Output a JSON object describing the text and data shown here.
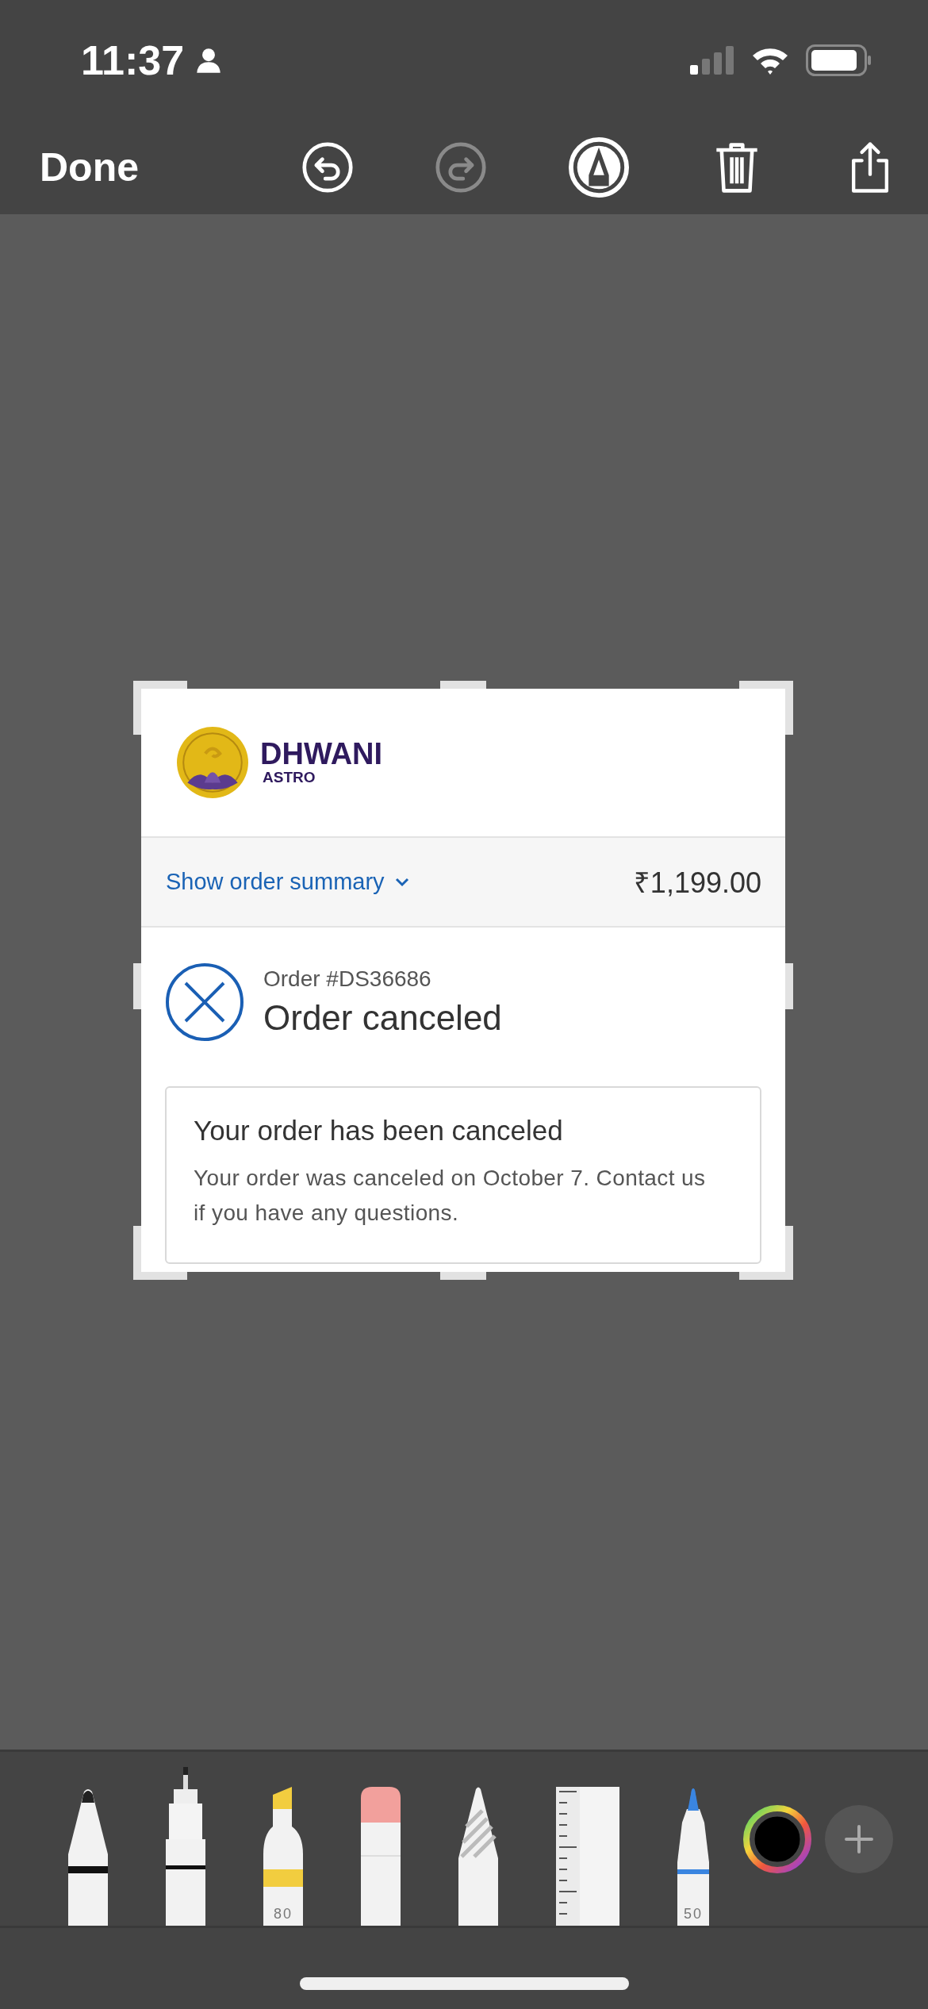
{
  "status_bar": {
    "time": "11:37"
  },
  "toolbar": {
    "done": "Done",
    "actions": [
      {
        "kind": "undo",
        "disabled": false
      },
      {
        "kind": "redo",
        "disabled": true
      },
      {
        "kind": "markup",
        "disabled": false
      },
      {
        "kind": "delete",
        "disabled": false
      },
      {
        "kind": "share",
        "disabled": false
      }
    ]
  },
  "card": {
    "brand": "DHWANI",
    "brand_sub": "ASTRO",
    "summary_link": "Show order summary",
    "total": "₹1,199.00",
    "order_number": "Order #DS36686",
    "status": "Order canceled",
    "notice": {
      "title": "Your order has been canceled",
      "body": "Your order was canceled on October 7. Contact us if you have any questions."
    }
  },
  "tools": [
    {
      "kind": "pen"
    },
    {
      "kind": "fineliner"
    },
    {
      "kind": "marker",
      "label": "80"
    },
    {
      "kind": "eraser"
    },
    {
      "kind": "pencil"
    },
    {
      "kind": "ruler"
    },
    {
      "kind": "crayon",
      "label": "50"
    }
  ]
}
